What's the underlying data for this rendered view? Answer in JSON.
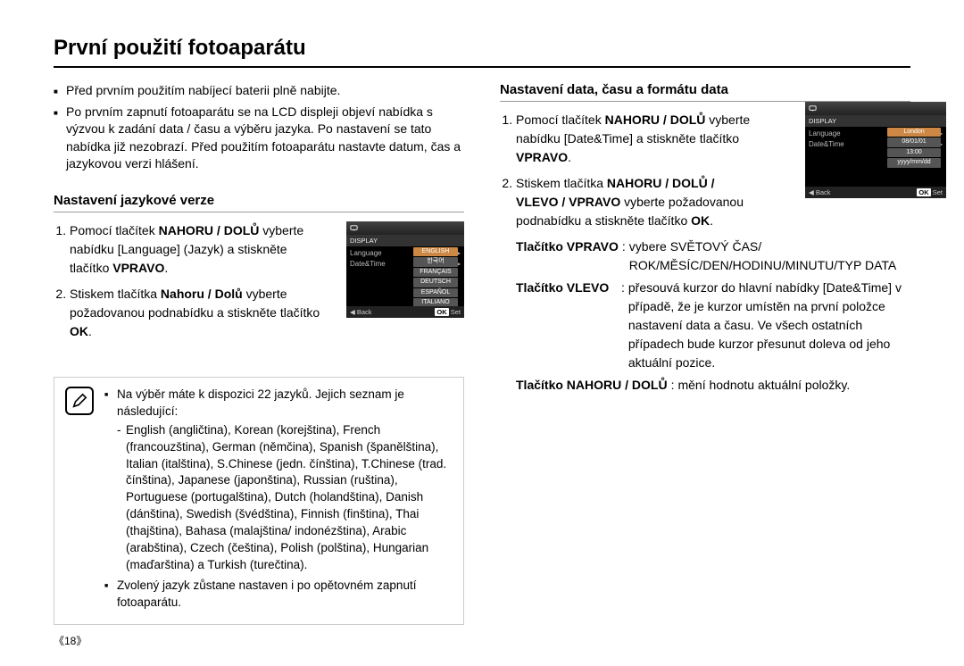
{
  "title": "První použití fotoaparátu",
  "intro_bullets": [
    "Před prvním použitím nabíjecí baterii plně nabijte.",
    "Po prvním zapnutí fotoaparátu se na LCD displeji objeví nabídka s výzvou k zadání data / času a výběru jazyka.  Po nastavení se tato nabídka již nezobrazí. Před použitím fotoaparátu nastavte datum, čas a jazykovou verzi hlášení."
  ],
  "lang_section": {
    "title": "Nastavení jazykové verze",
    "step1_pre": "Pomocí tlačítek ",
    "step1_bold": "NAHORU / DOLŮ",
    "step1_post": " vyberte nabídku [Language] (Jazyk) a stiskněte tlačítko ",
    "step1_bold2": "VPRAVO",
    "step1_dot": ".",
    "step2_pre": "Stiskem tlačítka ",
    "step2_bold": "Nahoru / Dolů",
    "step2_post": " vyberte požadovanou podnabídku a stiskněte tlačítko ",
    "step2_bold2": "OK",
    "step2_dot": "."
  },
  "lcd1": {
    "display": "DISPLAY",
    "language_row": "Language",
    "datetime_row": "Date&Time",
    "options": [
      "ENGLISH",
      "한국어",
      "FRANÇAIS",
      "DEUTSCH",
      "ESPAÑOL",
      "ITALIANO"
    ],
    "back": "Back",
    "ok": "OK",
    "set": "Set"
  },
  "note": {
    "bullet1": "Na výběr máte k dispozici 22 jazyků.  Jejich seznam je následující:",
    "langlist": "English (angličtina), Korean (korejština), French (francouzština), German (němčina), Spanish (španělština), Italian (italština), S.Chinese (jedn. čínština), T.Chinese (trad. čínština), Japanese (japonština), Russian (ruština), Portuguese (portugalština), Dutch (holandština), Danish (dánština), Swedish (švédština), Finnish (finština), Thai (thajština), Bahasa (malajština/ indonézština), Arabic (arabština), Czech (čeština), Polish (polština), Hungarian (maďarština) a Turkish (turečtina).",
    "bullet2": "Zvolený jazyk zůstane nastaven i po opětovném zapnutí fotoaparátu."
  },
  "datetime_section": {
    "title": "Nastavení data, času a formátu data",
    "step1_pre": "Pomocí tlačítek ",
    "step1_bold": "NAHORU / DOLŮ",
    "step1_post": " vyberte nabídku [Date&Time] a stiskněte tlačítko ",
    "step1_bold2": "VPRAVO",
    "step1_dot": ".",
    "step2_pre": "Stiskem tlačítka ",
    "step2_bold": "NAHORU / DOLŮ / VLEVO / VPRAVO",
    "step2_post": " vyberte požadovanou podnabídku a stiskněte tlačítko ",
    "step2_bold2": "OK",
    "step2_dot": ".",
    "row1_label": "Tlačítko VPRAVO",
    "row1_val": "vybere SVĚTOVÝ ČAS/ ROK/MĚSÍC/DEN/HODINU/MINUTU/TYP DATA",
    "row2_label": "Tlačítko VLEVO",
    "row2_val": "přesouvá kurzor do hlavní nabídky [Date&Time] v případě, že je kurzor umístěn na první položce nastavení data a času.  Ve všech ostatních případech bude kurzor přesunut doleva od jeho aktuální pozice.",
    "row3_label": "Tlačítko NAHORU / DOLŮ",
    "row3_val": "mění hodnotu aktuální položky."
  },
  "lcd2": {
    "display": "DISPLAY",
    "language_row": "Language",
    "datetime_row": "Date&Time",
    "options": [
      "London",
      "08/01/01",
      "13:00",
      "yyyy/mm/dd"
    ],
    "back": "Back",
    "ok": "OK",
    "set": "Set"
  },
  "page_number": "《18》"
}
